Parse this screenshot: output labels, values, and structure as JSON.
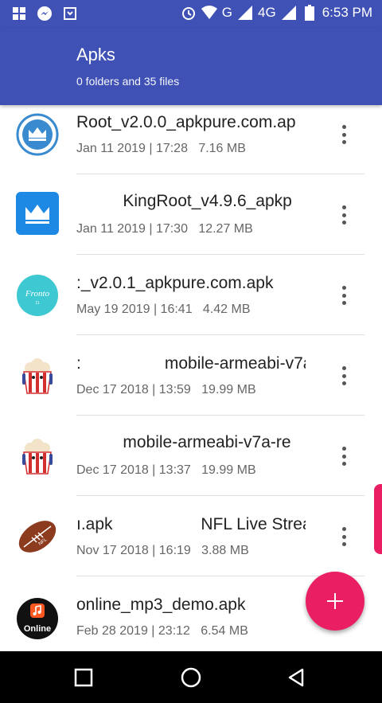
{
  "status_bar": {
    "left_icons": [
      "windows-icon",
      "messenger-icon",
      "download-box-icon"
    ],
    "network_label": "G",
    "network_label_2": "4G",
    "time": "6:53 PM"
  },
  "app_bar": {
    "title": "Apks",
    "subtitle": "0 folders and 35 files"
  },
  "files": [
    {
      "name": "Root_v2.0.0_apkpure.com.ap",
      "meta": "Jan 11 2019 | 17:28   7.16 MB",
      "icon": "circle-crown-app-icon"
    },
    {
      "name": "          KingRoot_v4.9.6_apkp",
      "meta": "Jan 11 2019 | 17:30   12.27 MB",
      "icon": "kingroot-crown-app-icon"
    },
    {
      "name": ":_v2.0.1_apkpure.com.apk",
      "meta": "May 19 2019 | 16:41   4.42 MB",
      "icon": "fronto-app-icon"
    },
    {
      "name": ":                  mobile-armeabi-v7a",
      "meta": "Dec 17 2018 | 13:59   19.99 MB",
      "icon": "popcorn-app-icon"
    },
    {
      "name": "          mobile-armeabi-v7a-re",
      "meta": "Dec 17 2018 | 13:37   19.99 MB",
      "icon": "popcorn-app-icon"
    },
    {
      "name": "ı.apk                   NFL Live Strea",
      "meta": "Nov 17 2018 | 16:19   3.88 MB",
      "icon": "nfl-football-app-icon"
    },
    {
      "name": "online_mp3_demo.apk",
      "meta": "Feb 28 2019 | 23:12   6.54 MB",
      "icon": "online-music-app-icon",
      "icon_text": "Online"
    }
  ],
  "colors": {
    "primary": "#3f51b5",
    "accent": "#e91e63"
  }
}
